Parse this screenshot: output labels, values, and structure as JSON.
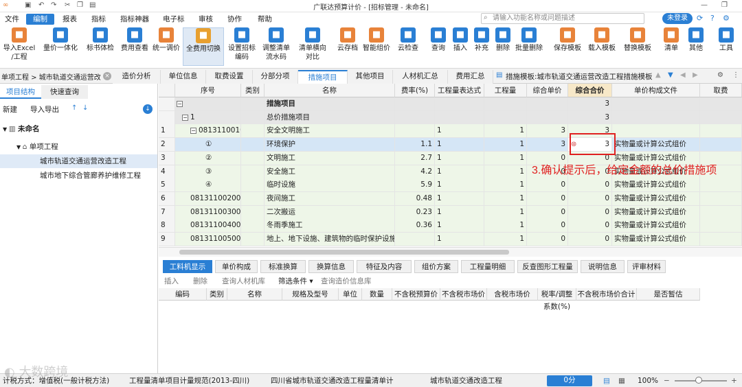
{
  "window": {
    "title": "广联达预算计价 - [招标管理 - 未命名]"
  },
  "menu": [
    "文件",
    "编制",
    "报表",
    "指标",
    "指标神器",
    "电子标",
    "审核",
    "协作",
    "帮助"
  ],
  "search": {
    "placeholder": "请输入功能名称或问题描述"
  },
  "login": "未登录",
  "ribbon": [
    {
      "label": "导入Excel\n/工程",
      "icon": "import-excel-icon",
      "color": "#e8833a"
    },
    {
      "label": "量价一体化",
      "icon": "qty-price-icon",
      "color": "#2a7fd4"
    },
    {
      "label": "标书体检",
      "icon": "bid-check-icon",
      "color": "#2a7fd4"
    },
    {
      "label": "费用查看",
      "icon": "fee-view-icon",
      "color": "#2a7fd4"
    },
    {
      "label": "统一调价",
      "icon": "adjust-price-icon",
      "color": "#e8833a"
    },
    {
      "label": "全费用切换",
      "icon": "full-fee-switch-icon",
      "color": "#e8a030"
    },
    {
      "label": "设置招标\n编码",
      "icon": "set-code-icon",
      "color": "#2a7fd4"
    },
    {
      "label": "调整清单\n流水码",
      "icon": "adjust-serial-icon",
      "color": "#2a7fd4"
    },
    {
      "label": "清单横向\n对比",
      "icon": "compare-icon",
      "color": "#2a7fd4"
    },
    {
      "label": "云存档",
      "icon": "cloud-save-icon",
      "color": "#e8833a"
    },
    {
      "label": "智能组价",
      "icon": "smart-price-icon",
      "color": "#e8833a"
    },
    {
      "label": "云检查",
      "icon": "cloud-check-icon",
      "color": "#2a7fd4"
    },
    {
      "label": "查询",
      "icon": "query-icon",
      "color": "#2a7fd4"
    },
    {
      "label": "插入",
      "icon": "insert-icon",
      "color": "#2a7fd4"
    },
    {
      "label": "补充",
      "icon": "supplement-icon",
      "color": "#2a7fd4"
    },
    {
      "label": "删除",
      "icon": "delete-icon",
      "color": "#2a7fd4"
    },
    {
      "label": "批量删除",
      "icon": "batch-delete-icon",
      "color": "#2a7fd4"
    },
    {
      "label": "保存模板",
      "icon": "save-template-icon",
      "color": "#e8833a"
    },
    {
      "label": "载入模板",
      "icon": "load-template-icon",
      "color": "#e8833a"
    },
    {
      "label": "替换模板",
      "icon": "replace-template-icon",
      "color": "#e8833a"
    },
    {
      "label": "清单",
      "icon": "list-icon",
      "color": "#e8833a"
    },
    {
      "label": "其他",
      "icon": "other-icon",
      "color": "#2a7fd4"
    },
    {
      "label": "工具",
      "icon": "tools-icon",
      "color": "#2a7fd4"
    }
  ],
  "breadcrumb": "单项工程 > 城市轨道交通运营改",
  "page_tabs": [
    "造价分析",
    "单位信息",
    "取费设置",
    "分部分项",
    "措施项目",
    "其他项目",
    "人材机汇总",
    "费用汇总"
  ],
  "template_label": "措施模板:城市轨道交通运营改造工程措施模板",
  "left": {
    "tabs": [
      "项目结构",
      "快速查询"
    ],
    "actions": {
      "new": "新建",
      "import_export": "导入导出"
    },
    "tree": [
      "未命名",
      "单项工程",
      "城市轨道交通运营改造工程",
      "城市地下综合管廊养护维修工程"
    ]
  },
  "grid": {
    "headers": [
      "序号",
      "类别",
      "名称",
      "费率(%)",
      "工程量表达式",
      "工程量",
      "综合单价",
      "综合合价",
      "单价构成文件",
      "取费"
    ],
    "rows": [
      {
        "idx": "",
        "code": "",
        "type": "",
        "name": "措施项目",
        "rate": "",
        "expr": "",
        "qty": "",
        "unit": "",
        "total": "3",
        "file": ""
      },
      {
        "idx": "",
        "code": "1",
        "type": "",
        "name": "总价措施项目",
        "rate": "",
        "expr": "",
        "qty": "",
        "unit": "",
        "total": "3",
        "file": ""
      },
      {
        "idx": "1",
        "code": "081311001001",
        "type": "",
        "name": "安全文明施工",
        "rate": "",
        "expr": "1",
        "qty": "1",
        "unit": "3",
        "total": "3",
        "file": ""
      },
      {
        "idx": "2",
        "code": "①",
        "type": "",
        "name": "环境保护",
        "rate": "1.1",
        "expr": "1",
        "qty": "1",
        "unit": "3",
        "total": "3",
        "file": "实物量或计算公式组价"
      },
      {
        "idx": "3",
        "code": "②",
        "type": "",
        "name": "文明施工",
        "rate": "2.7",
        "expr": "1",
        "qty": "1",
        "unit": "0",
        "total": "0",
        "file": "实物量或计算公式组价"
      },
      {
        "idx": "4",
        "code": "③",
        "type": "",
        "name": "安全施工",
        "rate": "4.2",
        "expr": "1",
        "qty": "1",
        "unit": "0",
        "total": "0",
        "file": "实物量或计算公式组价"
      },
      {
        "idx": "5",
        "code": "④",
        "type": "",
        "name": "临时设施",
        "rate": "5.9",
        "expr": "1",
        "qty": "1",
        "unit": "0",
        "total": "0",
        "file": "实物量或计算公式组价"
      },
      {
        "idx": "6",
        "code": "081311002001",
        "type": "",
        "name": "夜间施工",
        "rate": "0.48",
        "expr": "1",
        "qty": "1",
        "unit": "0",
        "total": "0",
        "file": "实物量或计算公式组价"
      },
      {
        "idx": "7",
        "code": "081311003001",
        "type": "",
        "name": "二次搬运",
        "rate": "0.23",
        "expr": "1",
        "qty": "1",
        "unit": "0",
        "total": "0",
        "file": "实物量或计算公式组价"
      },
      {
        "idx": "8",
        "code": "081311004001",
        "type": "",
        "name": "冬雨季施工",
        "rate": "0.36",
        "expr": "1",
        "qty": "1",
        "unit": "0",
        "total": "0",
        "file": "实物量或计算公式组价"
      },
      {
        "idx": "9",
        "code": "081311005001",
        "type": "",
        "name": "地上、地下设施、建筑物的临时保护设施",
        "rate": "",
        "expr": "1",
        "qty": "1",
        "unit": "0",
        "total": "0",
        "file": "实物量或计算公式组价"
      }
    ]
  },
  "annotation": "3.确认提示后，给定金额的总价措施项",
  "bottom": {
    "tabs": [
      "工料机显示",
      "单价构成",
      "标准换算",
      "换算信息",
      "特征及内容",
      "组价方案",
      "工程量明细",
      "反查图形工程量",
      "说明信息",
      "评审材料"
    ],
    "toolbar": [
      "插入",
      "删除",
      "查询人材机库",
      "筛选条件",
      "查询造价信息库"
    ],
    "columns": [
      "编码",
      "类别",
      "名称",
      "规格及型号",
      "单位",
      "数量",
      "不含税预算价",
      "不含税市场价",
      "含税市场价",
      "税率/调整系数(%)",
      "不含税市场价合计",
      "是否暂估"
    ]
  },
  "status": {
    "tax": "计税方式：增值税(一般计税方法)",
    "spec": "工程量清单项目计量规范(2013-四川)",
    "quota": "四川省城市轨道交通改造工程量清单计",
    "project": "城市轨道交通改造工程",
    "score": "0分",
    "zoom": "100%"
  },
  "watermark": "大数跨境"
}
